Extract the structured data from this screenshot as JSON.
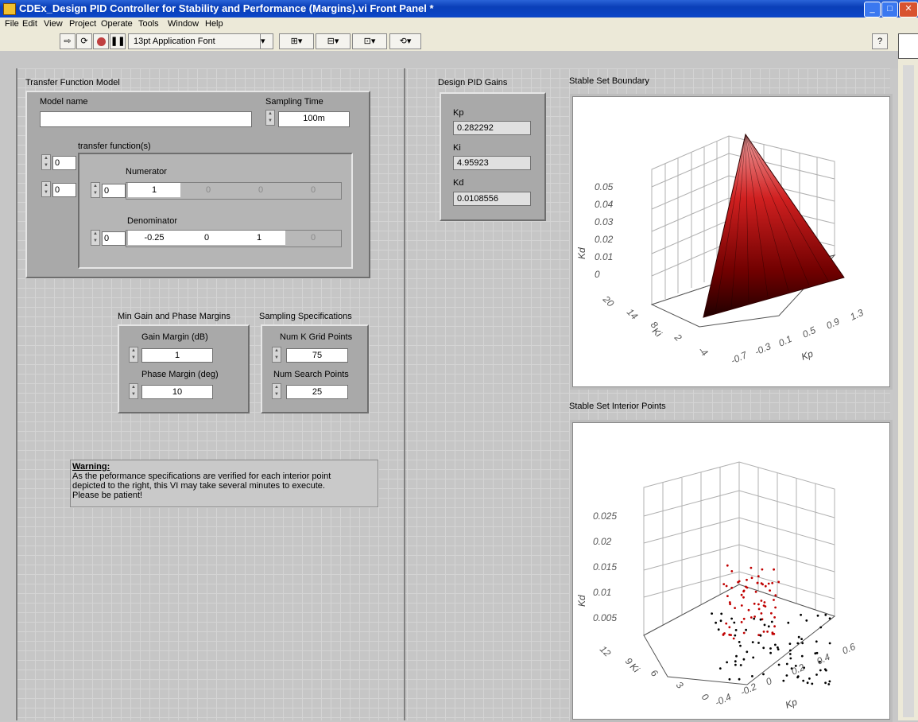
{
  "window": {
    "title": "CDEx_Design PID Controller for Stability and Performance (Margins).vi Front Panel *"
  },
  "menu": [
    "File",
    "Edit",
    "View",
    "Project",
    "Operate",
    "Tools",
    "Window",
    "Help"
  ],
  "toolbar": {
    "font_label": "13pt Application Font",
    "help_label": "?"
  },
  "transfer_function_model": {
    "section_label": "Transfer Function Model",
    "model_name_label": "Model name",
    "model_name_value": "",
    "sampling_time_label": "Sampling Time",
    "sampling_time_value": "100m",
    "tf_label": "transfer function(s)",
    "index_1": "0",
    "index_2": "0",
    "numerator_label": "Numerator",
    "numerator_index": "0",
    "numerator_values": [
      "1",
      "0",
      "0",
      "0"
    ],
    "denominator_label": "Denominator",
    "denominator_index": "0",
    "denominator_values": [
      "-0.25",
      "0",
      "1",
      "0"
    ]
  },
  "design_gains": {
    "section_label": "Design PID Gains",
    "kp_label": "Kp",
    "kp_value": "0.282292",
    "ki_label": "Ki",
    "ki_value": "4.95923",
    "kd_label": "Kd",
    "kd_value": "0.0108556"
  },
  "margins": {
    "section_label": "Min Gain and Phase Margins",
    "gain_margin_label": "Gain Margin (dB)",
    "gain_margin_value": "1",
    "phase_margin_label": "Phase Margin (deg)",
    "phase_margin_value": "10"
  },
  "sampling_specs": {
    "section_label": "Sampling Specifications",
    "grid_label": "Num K Grid Points",
    "grid_value": "75",
    "search_label": "Num Search Points",
    "search_value": "25"
  },
  "warning": {
    "title": "Warning:",
    "line1": "As the peformance specifications are verified for each interior point",
    "line2": "depicted to the right, this VI may take several minutes to execute.",
    "line3": "Please be patient!"
  },
  "boundary_graph": {
    "title": "Stable Set Boundary",
    "kd_ticks": [
      "0.05",
      "0.04",
      "0.03",
      "0.02",
      "0.01",
      "0"
    ],
    "ki_ticks": [
      "20",
      "14",
      "8",
      "2",
      "-4"
    ],
    "kp_ticks": [
      "1.3",
      "0.9",
      "0.5",
      "0.1",
      "-0.3",
      "-0.7"
    ],
    "kd_axis": "Kd",
    "ki_axis": "Ki",
    "kp_axis": "Kp"
  },
  "interior_graph": {
    "title": "Stable Set Interior Points",
    "kd_ticks": [
      "0.025",
      "0.02",
      "0.015",
      "0.01",
      "0.005"
    ],
    "ki_ticks": [
      "12",
      "9",
      "6",
      "3",
      "0"
    ],
    "kp_ticks": [
      "0.6",
      "0.4",
      "0.2",
      "0",
      "-0.2",
      "-0.4"
    ],
    "kd_axis": "Kd",
    "ki_axis": "Ki",
    "kp_axis": "Kp"
  },
  "colors": {
    "title_bar": "#0a3fb8",
    "panel": "#c6c6c6",
    "surface_red": "#c00000",
    "point_black": "#000000"
  }
}
